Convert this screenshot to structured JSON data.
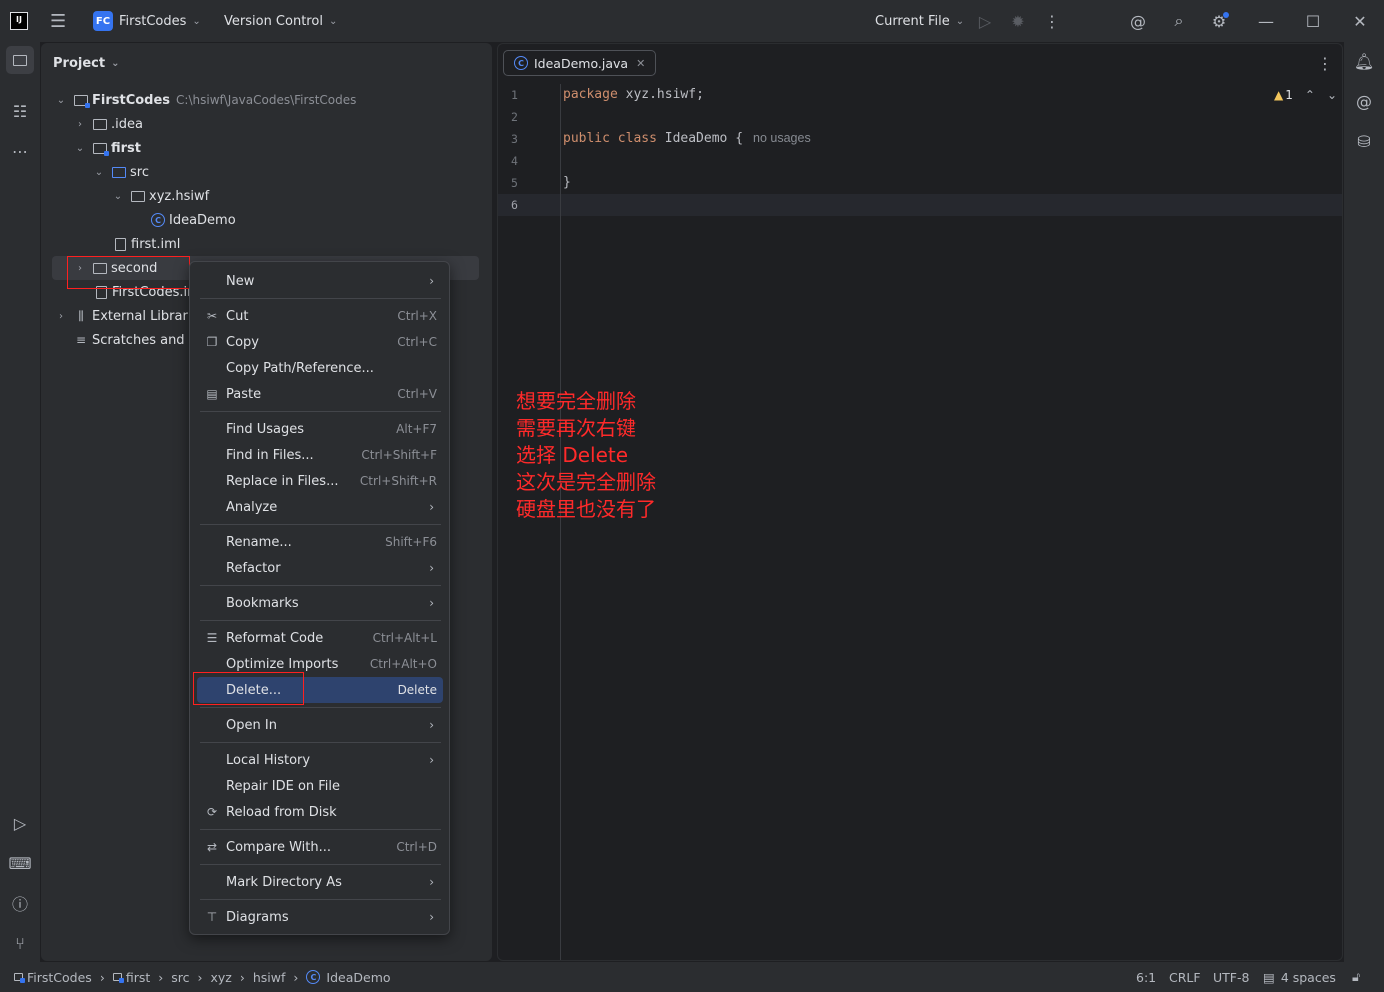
{
  "titlebar": {
    "app_icon": "intellij-logo-icon",
    "menu_icon": "hamburger-icon",
    "project_badge": "FC",
    "project_name": "FirstCodes",
    "vcs_label": "Version Control",
    "run_config": "Current File"
  },
  "project_panel": {
    "title": "Project",
    "tree": [
      {
        "label": "FirstCodes",
        "path": "C:\\hsiwf\\JavaCodes\\FirstCodes",
        "bold": true
      },
      {
        "label": ".idea"
      },
      {
        "label": "first",
        "bold": true
      },
      {
        "label": "src"
      },
      {
        "label": "xyz.hsiwf"
      },
      {
        "label": "IdeaDemo"
      },
      {
        "label": "first.iml"
      },
      {
        "label": "second"
      },
      {
        "label": "FirstCodes.im"
      },
      {
        "label": "External Librarie"
      },
      {
        "label": "Scratches and Cc"
      }
    ]
  },
  "editor": {
    "tab_label": "IdeaDemo.java",
    "warning_count": "1",
    "line_numbers": [
      "1",
      "2",
      "3",
      "4",
      "5",
      "6"
    ],
    "code": {
      "l1_kw": "package",
      "l1_rest": " xyz.hsiwf;",
      "l3_kw": "public class",
      "l3_cls": " IdeaDemo",
      "l3_rest": " {",
      "l3_hint": "no usages",
      "l5": "}"
    },
    "annotation_lines": [
      "想要完全删除",
      "需要再次右键",
      "选择 Delete",
      "这次是完全删除",
      "硬盘里也没有了"
    ]
  },
  "context_menu": {
    "items": [
      {
        "label": "New",
        "shortcut": "",
        "submenu": true
      },
      {
        "label": "Cut",
        "shortcut": "Ctrl+X",
        "icon": "scissors-icon"
      },
      {
        "label": "Copy",
        "shortcut": "Ctrl+C",
        "icon": "copy-icon"
      },
      {
        "label": "Copy Path/Reference...",
        "shortcut": ""
      },
      {
        "label": "Paste",
        "shortcut": "Ctrl+V",
        "icon": "paste-icon"
      },
      {
        "label": "Find Usages",
        "shortcut": "Alt+F7"
      },
      {
        "label": "Find in Files...",
        "shortcut": "Ctrl+Shift+F"
      },
      {
        "label": "Replace in Files...",
        "shortcut": "Ctrl+Shift+R"
      },
      {
        "label": "Analyze",
        "shortcut": "",
        "submenu": true
      },
      {
        "label": "Rename...",
        "shortcut": "Shift+F6"
      },
      {
        "label": "Refactor",
        "shortcut": "",
        "submenu": true
      },
      {
        "label": "Bookmarks",
        "shortcut": "",
        "submenu": true
      },
      {
        "label": "Reformat Code",
        "shortcut": "Ctrl+Alt+L",
        "icon": "reformat-icon"
      },
      {
        "label": "Optimize Imports",
        "shortcut": "Ctrl+Alt+O"
      },
      {
        "label": "Delete...",
        "shortcut": "Delete",
        "selected": true
      },
      {
        "label": "Open In",
        "shortcut": "",
        "submenu": true
      },
      {
        "label": "Local History",
        "shortcut": "",
        "submenu": true
      },
      {
        "label": "Repair IDE on File",
        "shortcut": ""
      },
      {
        "label": "Reload from Disk",
        "shortcut": "",
        "icon": "reload-icon"
      },
      {
        "label": "Compare With...",
        "shortcut": "Ctrl+D",
        "icon": "compare-icon"
      },
      {
        "label": "Mark Directory As",
        "shortcut": "",
        "submenu": true
      },
      {
        "label": "Diagrams",
        "shortcut": "",
        "submenu": true,
        "icon": "diagram-icon"
      }
    ]
  },
  "statusbar": {
    "breadcrumb": [
      "FirstCodes",
      "first",
      "src",
      "xyz",
      "hsiwf",
      "IdeaDemo"
    ],
    "position": "6:1",
    "line_sep": "CRLF",
    "encoding": "UTF-8",
    "indent": "4 spaces"
  }
}
